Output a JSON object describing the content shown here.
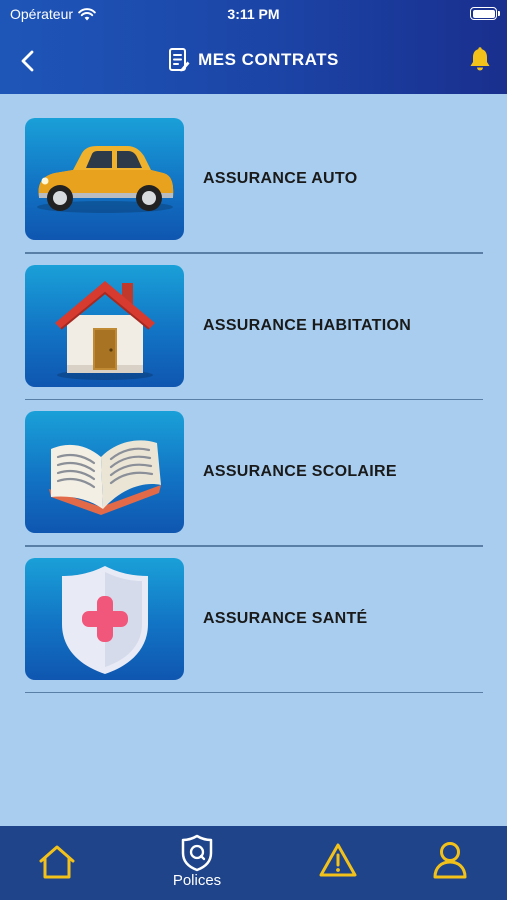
{
  "status_bar": {
    "carrier": "Opérateur",
    "time": "3:11 PM"
  },
  "header": {
    "title": "MES CONTRATS"
  },
  "contracts": [
    {
      "label": "ASSURANCE AUTO",
      "icon": "car-icon"
    },
    {
      "label": "ASSURANCE HABITATION",
      "icon": "house-icon"
    },
    {
      "label": "ASSURANCE SCOLAIRE",
      "icon": "book-icon"
    },
    {
      "label": "ASSURANCE SANTÉ",
      "icon": "health-shield-icon"
    }
  ],
  "tab_bar": {
    "tabs": [
      {
        "icon": "home-icon",
        "label": ""
      },
      {
        "icon": "shield-icon",
        "label": "Polices",
        "active": true
      },
      {
        "icon": "warning-icon",
        "label": ""
      },
      {
        "icon": "user-icon",
        "label": ""
      }
    ]
  },
  "colors": {
    "header_start": "#1e56b8",
    "header_end": "#1a2f8e",
    "background": "#a8cdef",
    "tab_bar": "#1f4489",
    "accent_yellow": "#f3c21a"
  }
}
